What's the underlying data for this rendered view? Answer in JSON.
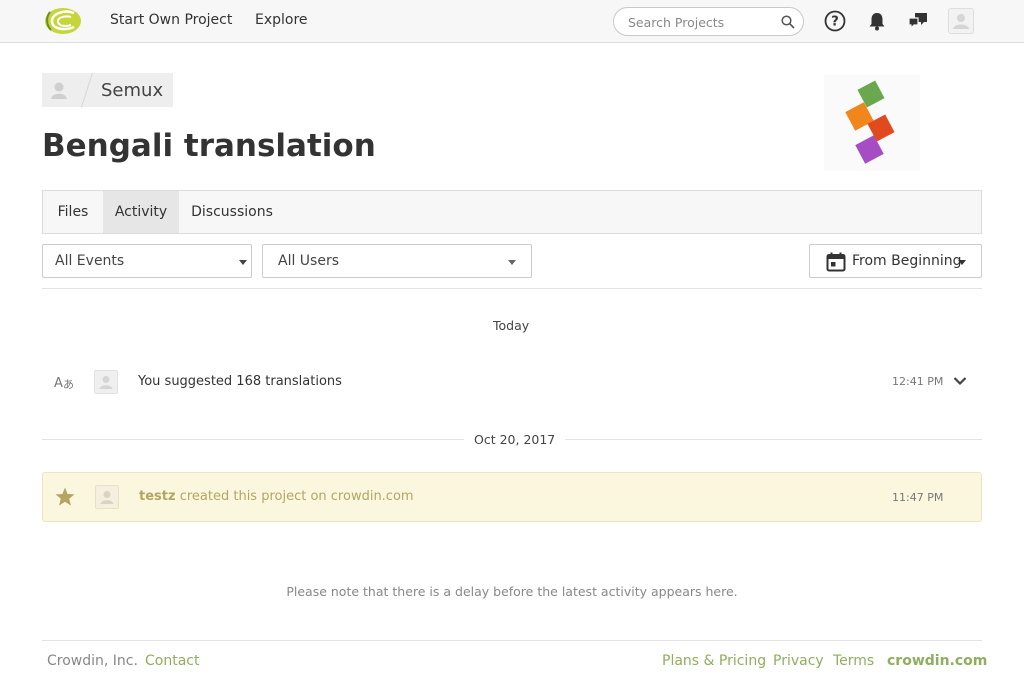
{
  "nav": {
    "logo_icon": "crowdin-logo-icon",
    "links": [
      "Start Own Project",
      "Explore"
    ],
    "search_placeholder": "Search Projects",
    "icons": [
      "help-icon",
      "bell-icon",
      "messages-icon"
    ]
  },
  "breadcrumb": {
    "owner": "Semux"
  },
  "page": {
    "title": "Bengali translation"
  },
  "tabs": [
    {
      "label": "Files",
      "active": false
    },
    {
      "label": "Activity",
      "active": true
    },
    {
      "label": "Discussions",
      "active": false
    }
  ],
  "filters": {
    "events": "All Events",
    "users": "All Users",
    "date": "From Beginning"
  },
  "activity": {
    "groups": [
      {
        "day": "Today",
        "items": [
          {
            "icon": "translate-icon",
            "text": "You suggested 168 translations",
            "time": "12:41 PM"
          }
        ]
      },
      {
        "day": "Oct 20, 2017",
        "items": [
          {
            "icon": "star-icon",
            "user": "testz",
            "text": "created this project on crowdin.com",
            "time": "11:47 PM"
          }
        ]
      }
    ]
  },
  "note": "Please note that there is a delay before the latest activity appears here.",
  "footer": {
    "company": "Crowdin, Inc.",
    "left_links": [
      "Contact"
    ],
    "right_links": [
      "Plans & Pricing",
      "Privacy",
      "Terms"
    ],
    "brand": "crowdin.com"
  },
  "colors": {
    "accent_green": "#8fae5e",
    "highlight_bg": "#fbf7df",
    "highlight_text": "#b3a663",
    "logo_squares": [
      "#6aa84f",
      "#f0861c",
      "#e04a1e",
      "#a64dc4"
    ]
  }
}
